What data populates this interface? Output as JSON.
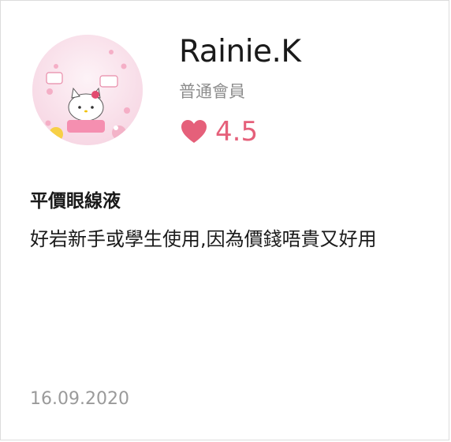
{
  "review": {
    "user": {
      "avatar_icon": "hello-kitty-avatar-icon",
      "name": "Rainie.K",
      "level": "普通會員"
    },
    "rating": {
      "icon": "heart-icon",
      "value": "4.5",
      "color": "#e5607a"
    },
    "title": "平價眼線液",
    "body": "好岩新手或學生使用,因為價錢唔貴又好用",
    "date": "16.09.2020"
  }
}
